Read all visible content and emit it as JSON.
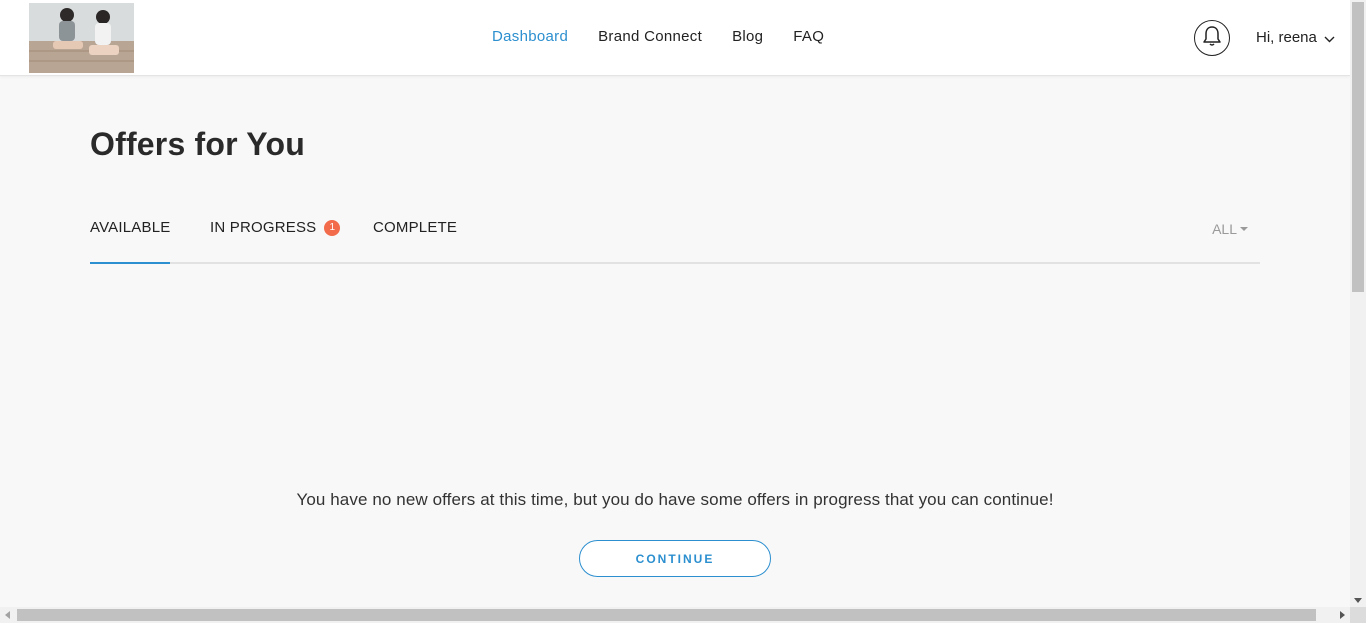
{
  "header": {
    "nav": [
      {
        "label": "Dashboard",
        "active": true
      },
      {
        "label": "Brand Connect",
        "active": false
      },
      {
        "label": "Blog",
        "active": false
      },
      {
        "label": "FAQ",
        "active": false
      }
    ],
    "notification_icon": "bell-icon",
    "user_greeting": "Hi, reena",
    "user_menu_icon": "chevron-down-icon"
  },
  "main": {
    "title": "Offers for You",
    "tabs": [
      {
        "label": "AVAILABLE",
        "active": true
      },
      {
        "label": "IN PROGRESS",
        "badge": "1"
      },
      {
        "label": "COMPLETE"
      }
    ],
    "filter_label": "ALL",
    "empty_message": "You have no new offers at this time, but you do have some offers in progress that you can continue!",
    "continue_label": "CONTINUE"
  },
  "colors": {
    "accent": "#2c8fcf",
    "badge": "#f26b4a",
    "background": "#f8f8f8"
  }
}
